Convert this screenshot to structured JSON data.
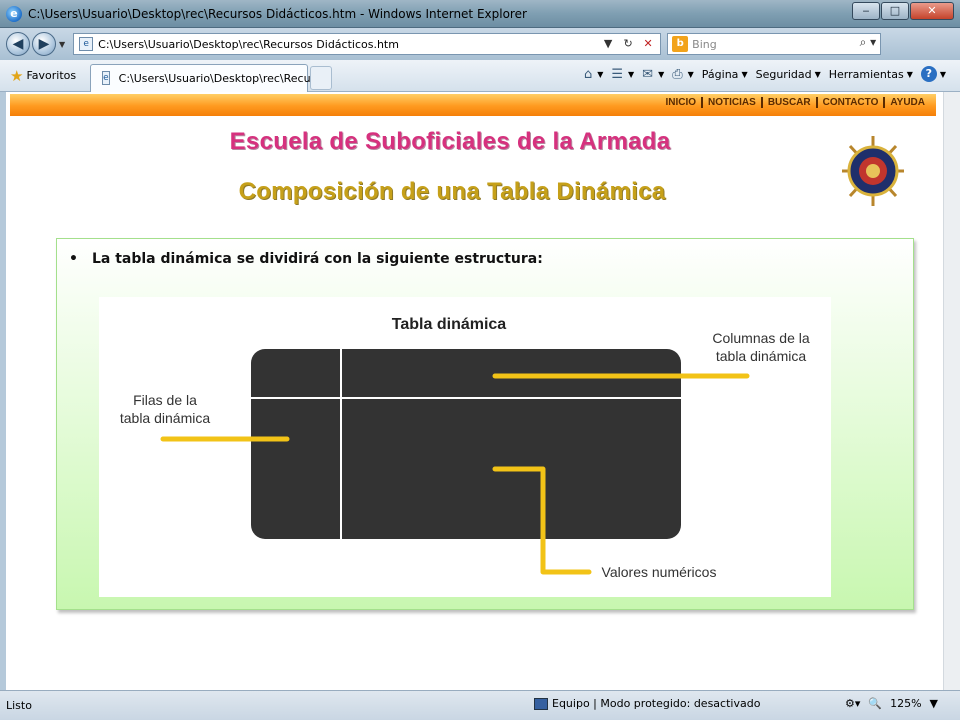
{
  "window": {
    "title": "C:\\Users\\Usuario\\Desktop\\rec\\Recursos Didácticos.htm - Windows Internet Explorer",
    "minimize": "‒",
    "maximize": "□",
    "close": "✕"
  },
  "address_bar": {
    "url": "C:\\Users\\Usuario\\Desktop\\rec\\Recursos Didácticos.htm",
    "search_placeholder": "Bing"
  },
  "favorites_bar": {
    "favorites_label": "Favoritos",
    "tab_title": "C:\\Users\\Usuario\\Desktop\\rec\\Recurs...",
    "commands": [
      "Página",
      "Seguridad",
      "Herramientas"
    ]
  },
  "site": {
    "nav": [
      "INICIO",
      "NOTICIAS",
      "BUSCAR",
      "CONTACTO",
      "AYUDA"
    ],
    "title": "Escuela de Suboficiales de la Armada",
    "subtitle": "Composición de una Tabla Dinámica",
    "bullet": "La tabla dinámica se dividirá con la siguiente estructura:",
    "figure": {
      "heading": "Tabla dinámica",
      "label_columns_1": "Columnas de la",
      "label_columns_2": "tabla dinámica",
      "label_rows_1": "Filas de la",
      "label_rows_2": "tabla dinámica",
      "label_values": "Valores numéricos",
      "accent_color": "#f2c317",
      "table_color": "#333333"
    }
  },
  "status_bar": {
    "left": "Listo",
    "zone": "Equipo | Modo protegido: desactivado",
    "zoom": "125%"
  }
}
